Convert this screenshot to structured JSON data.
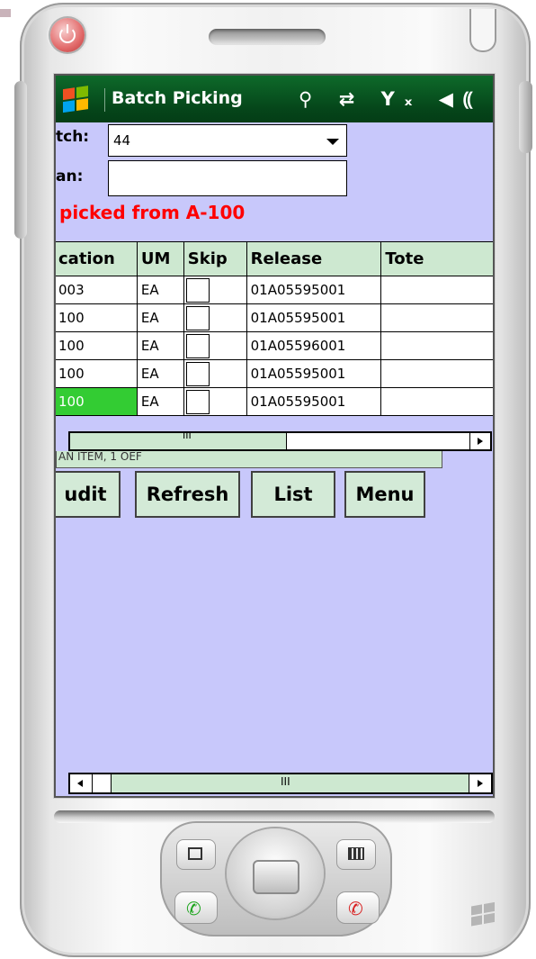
{
  "device": {
    "icons": [
      "power-icon",
      "speaker-grille",
      "windows-logo-icon",
      "calendar-key-icon",
      "contacts-key-icon",
      "call-icon",
      "end-call-icon"
    ]
  },
  "titlebar": {
    "title": "Batch Picking",
    "status_icons": "⚲ ⇄ Yₓ ◀⸨"
  },
  "form": {
    "batch_label": "tch:",
    "batch_value": "44",
    "scan_label": "an:",
    "scan_value": "",
    "message": "picked from A-100",
    "message_color": "#ff0000"
  },
  "grid": {
    "columns": [
      "cation",
      "UM",
      "Skip",
      "Release",
      "Tote"
    ],
    "rows": [
      {
        "location": "003",
        "um": "EA",
        "skip": false,
        "release": "01A05595001",
        "tote": ""
      },
      {
        "location": "100",
        "um": "EA",
        "skip": false,
        "release": "01A05595001",
        "tote": ""
      },
      {
        "location": "100",
        "um": "EA",
        "skip": false,
        "release": "01A05596001",
        "tote": ""
      },
      {
        "location": "100",
        "um": "EA",
        "skip": false,
        "release": "01A05595001",
        "tote": ""
      },
      {
        "location": "100",
        "um": "EA",
        "skip": false,
        "release": "01A05595001",
        "tote": "",
        "selected": true
      }
    ],
    "scroll_grip": "III"
  },
  "partial_text": "AN ITEM, 1 OEF",
  "buttons": {
    "audit": "udit",
    "refresh": "Refresh",
    "list": "List",
    "menu": "Menu"
  },
  "bottom_scroll": {
    "grip": "III"
  },
  "colors": {
    "titlebar": "#05461a",
    "screen_bg": "#c8c8fb",
    "header_bg": "#cde8d0",
    "selected_cell": "#33cc33"
  }
}
